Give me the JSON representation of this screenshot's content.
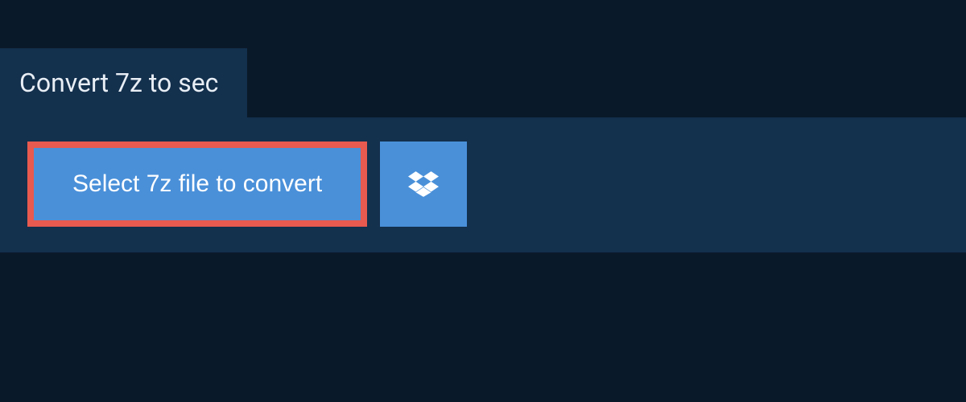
{
  "header": {
    "title": "Convert 7z to sec"
  },
  "actions": {
    "select_file_label": "Select 7z file to convert",
    "dropbox_icon": "dropbox-icon"
  }
}
